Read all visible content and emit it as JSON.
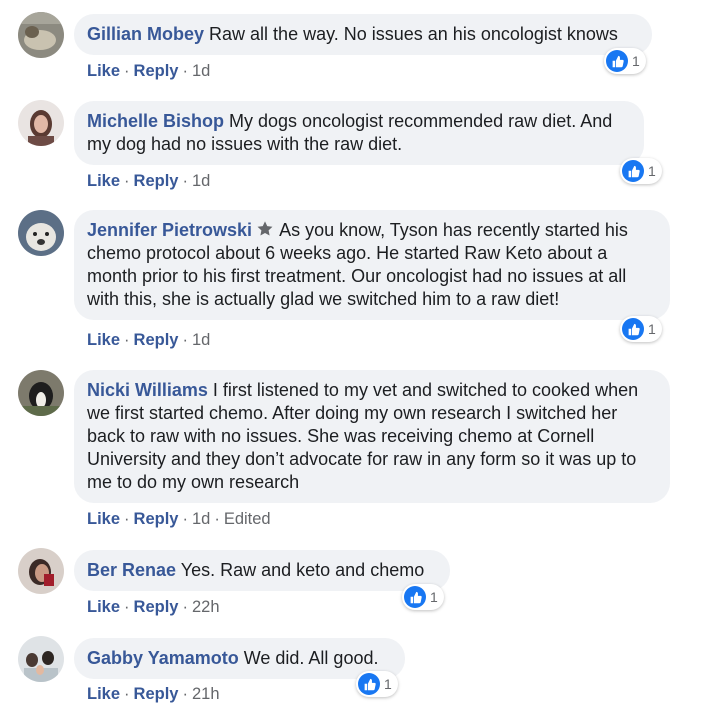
{
  "accent_color": "#385898",
  "like_color": "#1877f2",
  "comments": [
    {
      "author": "Gillian Mobey",
      "text": " Raw all the way. No issues an his oncologist knows",
      "like_label": "Like",
      "reply_label": "Reply",
      "time": "1d",
      "reactions": "1"
    },
    {
      "author": "Michelle Bishop",
      "text": " My dogs oncologist recommended raw diet. And my dog had no issues with the raw diet.",
      "like_label": "Like",
      "reply_label": "Reply",
      "time": "1d",
      "reactions": "1"
    },
    {
      "author": "Jennifer Pietrowski",
      "text": " As you know, Tyson has recently started his chemo protocol about 6 weeks ago. He started Raw Keto about a month prior to his first treatment. Our oncologist had no issues at all with this, she is actually glad we switched him to a raw diet!",
      "like_label": "Like",
      "reply_label": "Reply",
      "time": "1d",
      "reactions": "1",
      "badge_icon": "star-badge-icon"
    },
    {
      "author": "Nicki Williams",
      "text": " I first listened to my vet and switched to cooked when we first started chemo. After doing my own research I switched her back to raw with no issues. She was receiving chemo at Cornell University and they don’t advocate for raw in any form so it was up to me to do my own research",
      "like_label": "Like",
      "reply_label": "Reply",
      "time": "1d",
      "edited_label": "Edited"
    },
    {
      "author": "Ber Renae",
      "text": " Yes. Raw and keto and chemo",
      "like_label": "Like",
      "reply_label": "Reply",
      "time": "22h",
      "reactions": "1"
    },
    {
      "author": "Gabby Yamamoto",
      "text": " We did. All good.",
      "like_label": "Like",
      "reply_label": "Reply",
      "time": "21h",
      "reactions": "1"
    }
  ]
}
